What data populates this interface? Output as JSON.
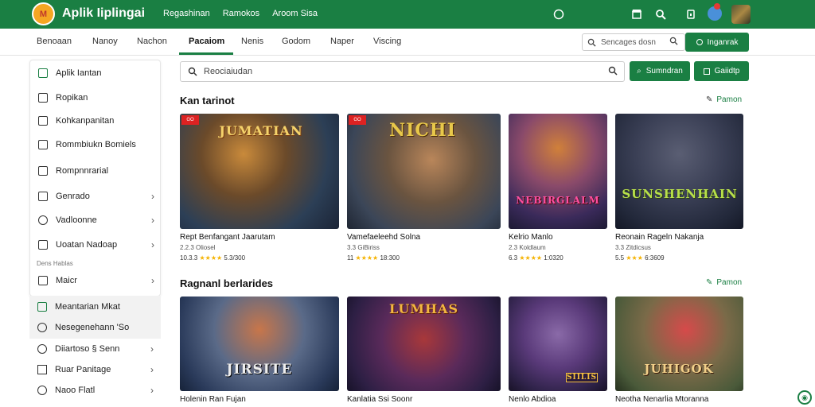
{
  "app": {
    "logo_text": "M",
    "brand": "Aplik Iiplingai"
  },
  "top_links": [
    "Regashinan",
    "Ramokos",
    "Aroom Sisa"
  ],
  "nav_tabs": [
    "Benoaan",
    "Nanoy",
    "Nachon",
    "Pacaiom",
    "Nenis",
    "Godom",
    "Naper",
    "Viscing"
  ],
  "active_tab": "Pacaiom",
  "top_search": {
    "placeholder": "Sencages dosn"
  },
  "top_button": "Inganrak",
  "sidebar": {
    "items": [
      {
        "label": "Aplik Iantan",
        "icon": "app-icon",
        "chevron": false
      },
      {
        "label": "Ropikan",
        "icon": "home-icon",
        "chevron": false
      },
      {
        "label": "Kohkanpanitan",
        "icon": "book-icon",
        "chevron": false
      },
      {
        "label": "Rommbiukn Bomiels",
        "icon": "list-icon",
        "chevron": false
      },
      {
        "label": "Rompnnrarial",
        "icon": "phone-icon",
        "chevron": false
      },
      {
        "label": "Genrado",
        "icon": "category-icon",
        "chevron": true
      },
      {
        "label": "Vadloonne",
        "icon": "tag-icon",
        "chevron": true
      },
      {
        "label": "Uoatan Nadoap",
        "icon": "folder-icon",
        "chevron": true
      },
      {
        "label": "Maicr",
        "icon": "menu-icon",
        "chevron": true
      }
    ],
    "section_head": "Dens Hablas",
    "extra": [
      {
        "label": "Meantarian Mkat",
        "icon": "settings-icon"
      },
      {
        "label": "Nesegenehann 'So",
        "icon": "shield-icon"
      }
    ],
    "bottom": [
      {
        "label": "Diiartoso § Senn",
        "icon": "circle-icon"
      },
      {
        "label": "Ruar Panitage",
        "icon": "square-icon"
      },
      {
        "label": "Naoo Flatl",
        "icon": "plus-icon"
      }
    ]
  },
  "main_search": {
    "placeholder": "Reociaiudan"
  },
  "action_buttons": [
    "Sumndran",
    "Gaiidtp"
  ],
  "section1": {
    "title": "Kan tarinot",
    "link": "Pamon"
  },
  "section2": {
    "title": "Ragnanl berlarides",
    "link": "Pamon"
  },
  "cards1": [
    {
      "title": "Rept Benfangant Jaarutam",
      "meta": "2.2.3 Oliosel",
      "rating": "10.3.3 ★★★★ 5.3/300",
      "art": "JUMATIAN",
      "tag": "GO"
    },
    {
      "title": "Vamefaeleehd Solna",
      "meta": "3.3 GiBiriss",
      "rating": "11 ★★★★ 18:300",
      "art": "NICHI",
      "tag": "GO"
    },
    {
      "title": "Kelrio Manlo",
      "meta": "2.3 Koldlaum",
      "rating": "6.3 ★★★★ 1:0320",
      "art": "NEBIRGLALM",
      "tag": ""
    },
    {
      "title": "Reonain Rageln Nakanja",
      "meta": "3.3 Zitdicsus",
      "rating": "5.5 ★★★ 6:3609",
      "art": "SUNSHENHAIN",
      "tag": ""
    }
  ],
  "cards2": [
    {
      "title": "Holenin Ran Fujan",
      "art": "JIRSITE"
    },
    {
      "title": "Kanlatia Ssi Soonr",
      "art": "LUMHAS"
    },
    {
      "title": "Nenlo Abdioa",
      "art": "SIILIS"
    },
    {
      "title": "Neotha Nenarlia Mtoranna",
      "art": "JUHIGOK"
    }
  ],
  "colors": {
    "brand": "#1a7f43",
    "star": "#f5b301",
    "tag_red": "#dd2222"
  }
}
